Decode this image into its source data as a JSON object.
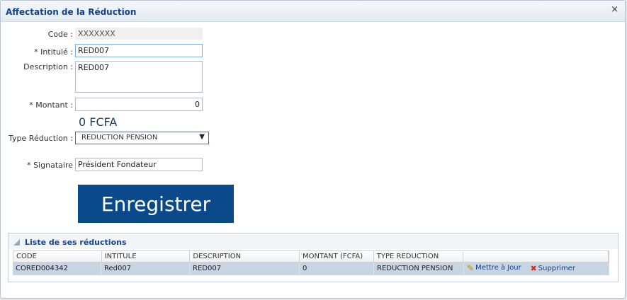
{
  "window": {
    "title": "Affectation de la Réduction",
    "close_glyph": "×"
  },
  "form": {
    "code_label": "Code :",
    "code_value": "XXXXXXX",
    "intitule_label": "* Intitulé :",
    "intitule_value": "RED007",
    "description_label": "Description :",
    "description_value": "RED007",
    "montant_label": "* Montant :",
    "montant_value": "0",
    "amount_display": "0 FCFA",
    "type_label": "Type Réduction :",
    "type_value": "REDUCTION PENSION",
    "signataire_label": "* Signataire",
    "signataire_value": "Président Fondateur",
    "save_label": "Enregistrer"
  },
  "list": {
    "title": "Liste de ses réductions",
    "columns": [
      "CODE",
      "INTITULE",
      "DESCRIPTION",
      "MONTANT (FCFA)",
      "TYPE REDUCTION",
      ""
    ],
    "rows": [
      {
        "code": "CORED004342",
        "intitule": "Red007",
        "description": "RED007",
        "montant": "0",
        "type": "REDUCTION PENSION",
        "update_label": "Mettre à Jour",
        "delete_label": "Supprimer"
      }
    ]
  },
  "icons": {
    "close": "close-icon",
    "dropdown": "chevron-down-icon",
    "edit": "pencil-icon",
    "delete": "delete-icon",
    "collapse": "collapse-triangle-icon"
  }
}
